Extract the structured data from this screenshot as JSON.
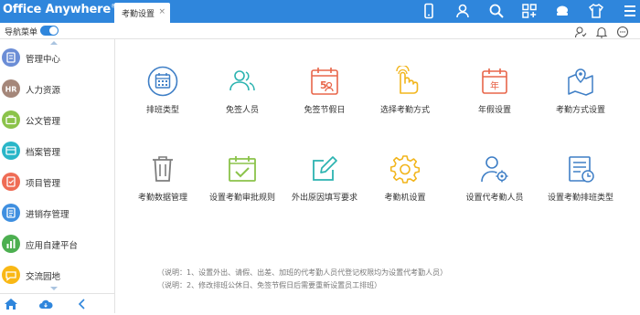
{
  "app": {
    "logo_text": "Office Anywhere",
    "logo_mark": "®"
  },
  "tab": {
    "label": "考勤设置",
    "close": "×"
  },
  "top_icons": [
    "mobile-icon",
    "user-icon",
    "search-icon",
    "apps-icon",
    "skin-icon",
    "shirt-icon",
    "menu-icon"
  ],
  "subbar": {
    "nav_label": "导航菜单",
    "toggle_on": true
  },
  "sub_icons": [
    "contacts-icon",
    "bell-icon",
    "chat-icon"
  ],
  "sidebar": {
    "items": [
      {
        "label": "管理中心",
        "color": "#6b8dd6"
      },
      {
        "label": "人力资源",
        "color": "#a5877a"
      },
      {
        "label": "公文管理",
        "color": "#8bc34a"
      },
      {
        "label": "档案管理",
        "color": "#29b6c8"
      },
      {
        "label": "项目管理",
        "color": "#ef6c55"
      },
      {
        "label": "进销存管理",
        "color": "#3f8fe0"
      },
      {
        "label": "应用自建平台",
        "color": "#4caf50"
      },
      {
        "label": "交流园地",
        "color": "#f9b815"
      }
    ],
    "footer_icons": [
      "home-icon",
      "cloud-icon",
      "collapse-icon"
    ]
  },
  "grid": {
    "items": [
      {
        "label": "排班类型",
        "icon": "calendar-grid-icon",
        "color": "#3f7fc6"
      },
      {
        "label": "免签人员",
        "icon": "users-icon",
        "color": "#2bb3b0"
      },
      {
        "label": "免签节假日",
        "icon": "holiday-icon",
        "color": "#e8664a"
      },
      {
        "label": "选择考勤方式",
        "icon": "hand-pointer-icon",
        "color": "#f2b51c"
      },
      {
        "label": "年假设置",
        "icon": "annual-calendar-icon",
        "color": "#e8664a"
      },
      {
        "label": "考勤方式设置",
        "icon": "map-pin-icon",
        "color": "#3f7fc6"
      },
      {
        "label": "考勤数据管理",
        "icon": "trash-icon",
        "color": "#7d7d7d"
      },
      {
        "label": "设置考勤审批规则",
        "icon": "calendar-check-icon",
        "color": "#8bc34a"
      },
      {
        "label": "外出原因填写要求",
        "icon": "edit-icon",
        "color": "#2bb3b0"
      },
      {
        "label": "考勤机设置",
        "icon": "gear-icon",
        "color": "#f2b51c"
      },
      {
        "label": "设置代考勤人员",
        "icon": "user-gear-icon",
        "color": "#3f7fc6"
      },
      {
        "label": "设置考勤排班类型",
        "icon": "list-calendar-icon",
        "color": "#3f7fc6"
      }
    ]
  },
  "notes": [
    "（说明：1、设置外出、请假、出差、加班的代考勤人员代登记权限均为设置代考勤人员）",
    "（说明：2、修改排班公休日、免签节假日后需要重新设置员工排班）"
  ]
}
